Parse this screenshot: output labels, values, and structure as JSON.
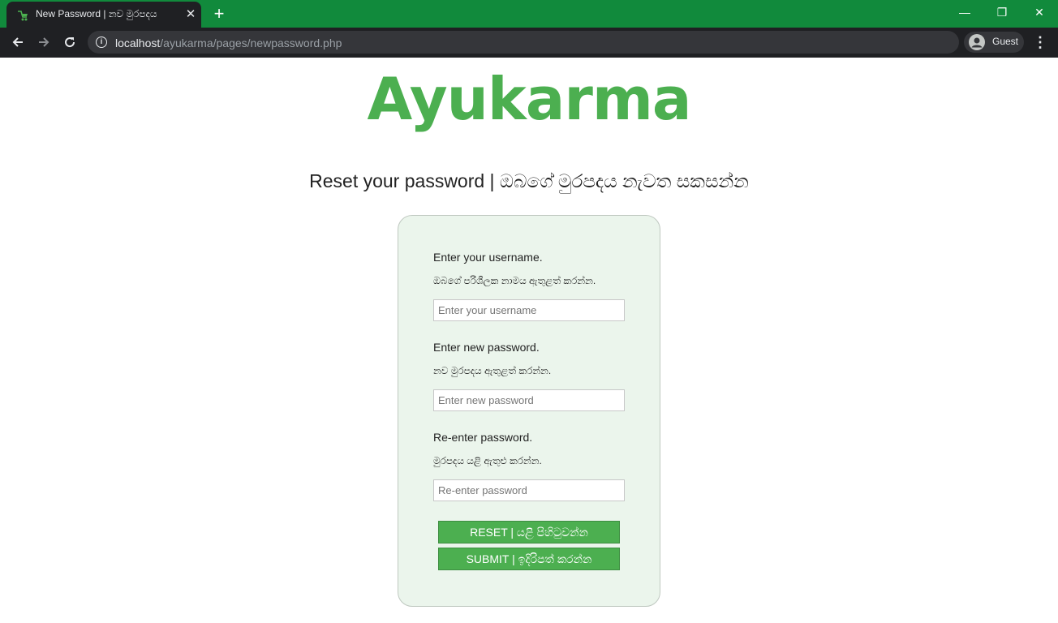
{
  "browser": {
    "tab_title": "New Password | නව මුරපදය",
    "tab_close": "✕",
    "new_tab": "+",
    "window_minimize": "—",
    "window_restore": "❐",
    "window_close": "✕",
    "url_host": "localhost",
    "url_path": "/ayukarma/pages/newpassword.php",
    "profile_label": "Guest",
    "icons": {
      "back": "arrow-left-icon",
      "forward": "arrow-right-icon",
      "reload": "reload-icon",
      "info": "info-icon",
      "menu": "kebab-menu-icon"
    }
  },
  "page": {
    "logo": "Ayukarma",
    "title": "Reset your password | ඔබගේ මුරපදය නැවත සකසන්න",
    "form": {
      "username_label": "Enter your username.",
      "username_sublabel": "ඔබගේ පරිශීලක නාමය ඇතුළත් කරන්න.",
      "username_placeholder": "Enter your username",
      "newpass_label": "Enter new password.",
      "newpass_sublabel": "නව මුරපදය ඇතුළත් කරන්න.",
      "newpass_placeholder": "Enter new password",
      "repass_label": "Re-enter password.",
      "repass_sublabel": "මුරපදය යළි ඇතුළු කරන්න.",
      "repass_placeholder": "Re-enter password",
      "reset_button": "RESET | යළි පිහිටුවන්න",
      "submit_button": "SUBMIT | ඉදිරිපත් කරන්න"
    }
  },
  "colors": {
    "brand_green": "#4caf50",
    "titlebar_green": "#118a3c",
    "card_background": "#ebf5ec"
  }
}
